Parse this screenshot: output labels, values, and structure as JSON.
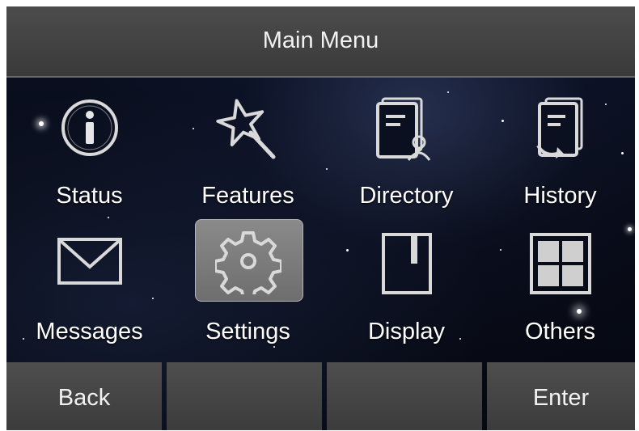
{
  "header": {
    "title": "Main Menu"
  },
  "menu": {
    "items": [
      {
        "label": "Status",
        "icon": "info-icon"
      },
      {
        "label": "Features",
        "icon": "magic-wand-icon"
      },
      {
        "label": "Directory",
        "icon": "contact-book-icon"
      },
      {
        "label": "History",
        "icon": "call-history-icon"
      },
      {
        "label": "Messages",
        "icon": "envelope-icon"
      },
      {
        "label": "Settings",
        "icon": "gear-icon",
        "selected": true
      },
      {
        "label": "Display",
        "icon": "display-icon"
      },
      {
        "label": "Others",
        "icon": "grid-icon"
      }
    ]
  },
  "softkeys": {
    "back": "Back",
    "key2": "",
    "key3": "",
    "enter": "Enter"
  },
  "colors": {
    "header_bg": "#3f3f3f",
    "selected_bg": "#7c7c7c",
    "icon_stroke": "#d9d9d9",
    "text": "#ffffff"
  }
}
